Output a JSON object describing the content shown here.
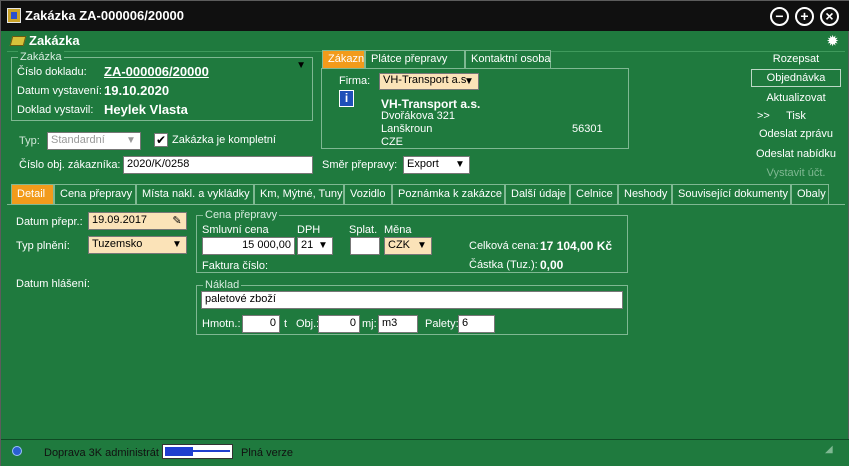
{
  "window": {
    "title": "Zakázka ZA-000006/20000"
  },
  "header": {
    "caption": "Zakázka"
  },
  "zakazka_group": {
    "legend": "Zakázka",
    "cislo_label": "Číslo dokladu:",
    "cislo_value": "ZA-000006/20000",
    "datum_label": "Datum vystavení:",
    "datum_value": "19.10.2020",
    "vystavil_label": "Doklad vystavil:",
    "vystavil_value": "Heylek Vlasta"
  },
  "typ": {
    "label": "Typ:",
    "value": "Standardní"
  },
  "kompletni": {
    "label": "Zakázka je kompletní",
    "checked": true
  },
  "cislo_obj": {
    "label": "Číslo obj. zákazníka:",
    "value": "2020/K/0258"
  },
  "smer": {
    "label": "Směr přepravy:",
    "value": "Export"
  },
  "top_tabs": [
    "Zákazník",
    "Plátce přepravy",
    "Kontaktní osoba"
  ],
  "customer": {
    "firma_label": "Firma:",
    "firma_select": "VH-Transport a.s",
    "name": "VH-Transport a.s.",
    "street": "Dvořákova 321",
    "city": "Lanškroun",
    "zip": "56301",
    "country": "CZE",
    "info_icon": "info-icon"
  },
  "side_buttons": {
    "rozepsat": "Rozepsat",
    "objednavka": "Objednávka",
    "aktualizovat": "Aktualizovat",
    "more": ">>",
    "tisk": "Tisk",
    "odeslat_zpravu": "Odeslat zprávu",
    "odeslat_nabidku": "Odeslat nabídku",
    "vystavit": "Vystavit účt."
  },
  "bottom_tabs": [
    "Detail",
    "Cena přepravy",
    "Místa nakl. a vykládky",
    "Km, Mýtné, Tuny",
    "Vozidlo",
    "Poznámka k zakázce",
    "Další údaje",
    "Celnice",
    "Neshody",
    "Související dokumenty",
    "Obaly"
  ],
  "detail": {
    "datum_prepr_label": "Datum přepr.:",
    "datum_prepr_value": "19.09.2017",
    "typ_plneni_label": "Typ plnění:",
    "typ_plneni_value": "Tuzemsko",
    "datum_hlaseni_label": "Datum hlášení:"
  },
  "cena": {
    "legend": "Cena přepravy",
    "smluvni_label": "Smluvní cena",
    "smluvni_value": "15 000,00",
    "dph_label": "DPH",
    "dph_value": "21",
    "splat_label": "Splat.",
    "splat_value": "",
    "mena_label": "Měna",
    "mena_value": "CZK",
    "celkova_label": "Celková cena:",
    "celkova_value": "17 104,00 Kč",
    "castka_label": "Částka (Tuz.):",
    "castka_value": "0,00",
    "faktura_label": "Faktura číslo:"
  },
  "naklad": {
    "legend": "Náklad",
    "popis": "paletové zboží",
    "hmotn_label": "Hmotn.:",
    "hmotn_value": "0",
    "hmotn_unit": "t",
    "obj_label": "Obj.:",
    "obj_value": "0",
    "mj_label": "mj:",
    "mj_value": "m3",
    "palety_label": "Palety:",
    "palety_value": "6"
  },
  "status": {
    "user": "Doprava 3K administrát",
    "version": "Plná verze"
  },
  "colors": {
    "background": "#1f7a3e",
    "active_tab": "#f29b1b",
    "input_yellow": "#fbe3b8"
  }
}
